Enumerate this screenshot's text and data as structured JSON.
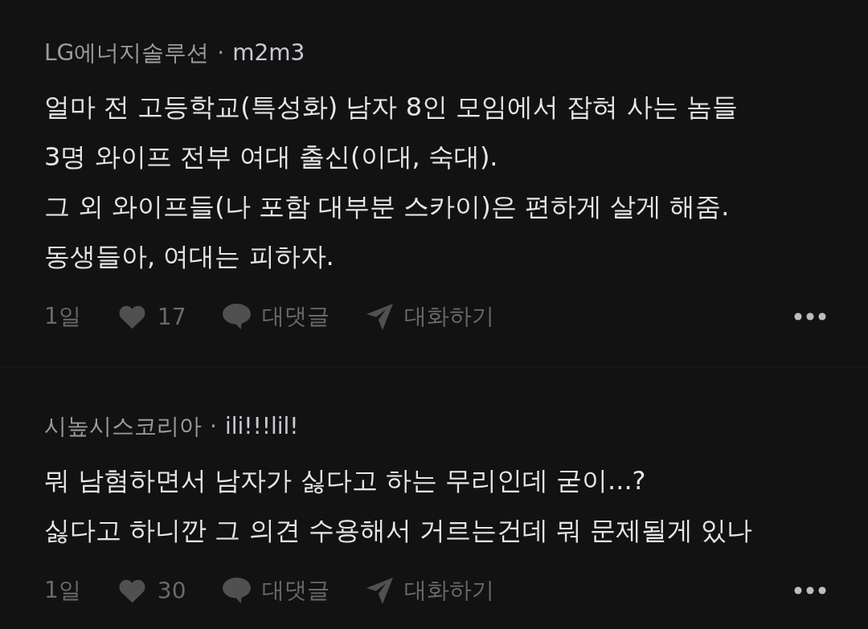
{
  "comments": [
    {
      "company": "LG에너지솔루션",
      "separator": "·",
      "nickname": "m2m3",
      "lines": [
        "얼마 전 고등학교(특성화) 남자 8인 모임에서 잡혀 사는 놈들",
        "3명 와이프 전부 여대 출신(이대, 숙대).",
        "그 외 와이프들(나 포함 대부분 스카이)은 편하게 살게 해줌.",
        "동생들아, 여대는 피하자."
      ],
      "time": "1일",
      "likes": "17",
      "reply_label": "대댓글",
      "chat_label": "대화하기"
    },
    {
      "company": "시높시스코리아",
      "separator": "·",
      "nickname": "ili!!!lil!",
      "lines": [
        "뭐 남혐하면서 남자가 싫다고 하는 무리인데 굳이...?",
        "싫다고 하니깐 그 의견 수용해서 거르는건데 뭐 문제될게 있나"
      ],
      "time": "1일",
      "likes": "30",
      "reply_label": "대댓글",
      "chat_label": "대화하기"
    }
  ]
}
